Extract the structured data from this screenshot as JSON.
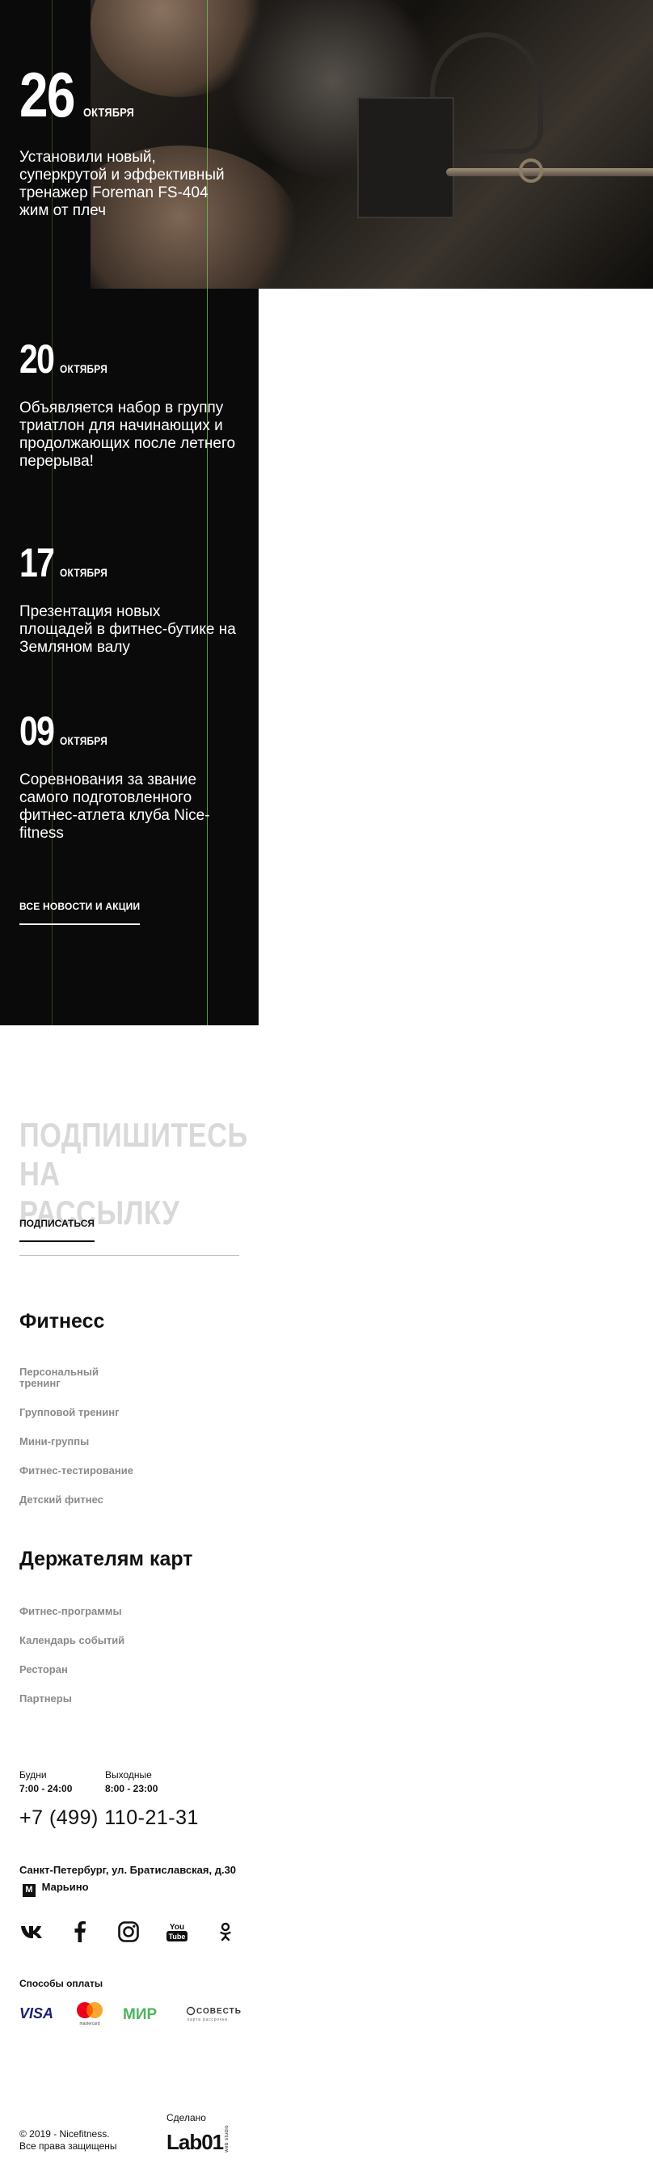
{
  "news": [
    {
      "day": "26",
      "month": "ОКТЯБРЯ",
      "title": "Установили новый, суперкрутой и эффективный тренажер Foreman FS-404 жим от плеч"
    },
    {
      "day": "20",
      "month": "ОКТЯБРЯ",
      "title": "Объявляется набор в группу триатлон для начинающих и продолжающих после летнего перерыва!"
    },
    {
      "day": "17",
      "month": "ОКТЯБРЯ",
      "title": "Презентация новых площадей в фитнес-бутике на Земляном валу"
    },
    {
      "day": "09",
      "month": "ОКТЯБРЯ",
      "title": "Соревнования за звание самого подготовленного фитнес-атлета клуба Nice-fitness"
    }
  ],
  "all_news_label": "ВСЕ НОВОСТИ И АКЦИИ",
  "subscribe": {
    "title": "ПОДПИШИТЕСЬ НА РАССЫЛКУ",
    "link": "ПОДПИСАТЬСЯ"
  },
  "fitness": {
    "title": "Фитнесс",
    "items": [
      "Персональный тренинг",
      "Групповой тренинг",
      "Мини-группы",
      "Фитнес-тестирование",
      "Детский фитнес"
    ]
  },
  "card_holders": {
    "title": "Держателям карт",
    "items": [
      "Фитнес-программы",
      "Календарь событий",
      "Ресторан",
      "Партнеры"
    ]
  },
  "hours": {
    "weekdays_label": "Будни",
    "weekdays_value": "7:00 - 24:00",
    "weekend_label": "Выходные",
    "weekend_value": "8:00 - 23:00"
  },
  "phone": "+7 (499) 110-21-31",
  "address": {
    "street": "Санкт-Петербург, ул. Братиславская, д.30",
    "metro_letter": "М",
    "metro": "Марьино"
  },
  "socials": [
    "vk-icon",
    "facebook-icon",
    "instagram-icon",
    "youtube-icon",
    "odnoklassniki-icon"
  ],
  "youtube_logo": {
    "line1": "You",
    "line2": "Tube"
  },
  "payments_title": "Способы оплаты",
  "payments": {
    "visa": "VISA",
    "mastercard": "mastercard",
    "mir": "МИР",
    "sovest": "СОВЕСТЬ",
    "sovest_sub": "карта рассрочки"
  },
  "copyright": {
    "line1": "© 2019 - Nicefitness.",
    "line2": "Все права защищены"
  },
  "made_by": {
    "label": "Сделано",
    "logo": "Lab01",
    "small": "web studio"
  },
  "colors": {
    "news_bg": "#0a0a0a",
    "accent_line": "#6fbf3a",
    "muted_title": "#d9d9d9"
  }
}
